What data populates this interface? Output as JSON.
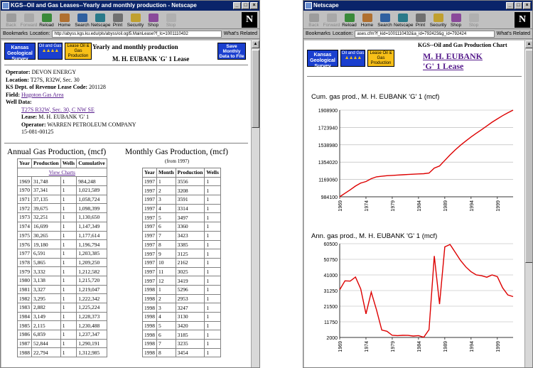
{
  "left_window": {
    "title": "KGS--Oil and Gas Leases--Yearly and monthly production - Netscape",
    "toolbar": [
      "Back",
      "Forward",
      "Reload",
      "Home",
      "Search",
      "Netscape",
      "Print",
      "Security",
      "Shop",
      "Stop"
    ],
    "bookmarks": "Bookmarks",
    "location_label": "Location:",
    "url": "http://abyss.kgs.ku.edu/pls/abyss/oil.ogl5.MainLease?f_lc=1001110432",
    "related": "What's Related",
    "logos": {
      "kgs": "Kansas Geological Survey",
      "oil_gas": "Oil and Gas",
      "lease": "Lease Oil & Gas Production",
      "save": "Save Monthly Data to File"
    },
    "heading": "Yearly and monthly production",
    "lease_title": "M. H. EUBANK 'G' 1 Lease",
    "info": [
      {
        "label": "Operator:",
        "value": "DEVON ENERGY"
      },
      {
        "label": "Location:",
        "value": "T27S, R32W, Sec. 30"
      },
      {
        "label": "KS Dept. of Revenue Lease Code:",
        "value": "201128"
      }
    ],
    "field_label": "Field:",
    "field_value": "Hugoton Gas Area",
    "well_data_label": "Well Data:",
    "well_link": "T27S R32W, Sec. 30, C NW SE",
    "well_lease_label": "Lease:",
    "well_lease_value": "M. H. EUBANK 'G' 1",
    "well_operator_label": "Operator:",
    "well_operator_value": "WARREN PETROLEUM COMPANY",
    "api": "15-081-00125",
    "annual_title": "Annual Gas Production, (mcf)",
    "monthly_title": "Monthly Gas Production, (mcf)",
    "monthly_sub": "(from 1997)",
    "view_charts": "View Charts",
    "annual_headers": [
      "Year",
      "Production",
      "Wells",
      "Cumulative"
    ],
    "annual_rows": [
      [
        "1969",
        "31,748",
        "1",
        "984,248"
      ],
      [
        "1970",
        "37,341",
        "1",
        "1,021,589"
      ],
      [
        "1971",
        "37,135",
        "1",
        "1,058,724"
      ],
      [
        "1972",
        "39,675",
        "1",
        "1,098,399"
      ],
      [
        "1973",
        "32,251",
        "1",
        "1,130,650"
      ],
      [
        "1974",
        "16,699",
        "1",
        "1,147,349"
      ],
      [
        "1975",
        "30,265",
        "1",
        "1,177,614"
      ],
      [
        "1976",
        "19,180",
        "1",
        "1,196,794"
      ],
      [
        "1977",
        "6,591",
        "1",
        "1,203,385"
      ],
      [
        "1978",
        "5,865",
        "1",
        "1,209,250"
      ],
      [
        "1979",
        "3,332",
        "1",
        "1,212,582"
      ],
      [
        "1980",
        "3,138",
        "1",
        "1,215,720"
      ],
      [
        "1981",
        "3,327",
        "1",
        "1,219,047"
      ],
      [
        "1982",
        "3,295",
        "1",
        "1,222,342"
      ],
      [
        "1983",
        "2,882",
        "1",
        "1,225,224"
      ],
      [
        "1984",
        "3,149",
        "1",
        "1,228,373"
      ],
      [
        "1985",
        "2,115",
        "1",
        "1,230,488"
      ],
      [
        "1986",
        "6,859",
        "1",
        "1,237,347"
      ],
      [
        "1987",
        "52,844",
        "1",
        "1,290,191"
      ],
      [
        "1988",
        "22,794",
        "1",
        "1,312,985"
      ]
    ],
    "monthly_headers": [
      "Year",
      "Month",
      "Production",
      "Wells"
    ],
    "monthly_rows": [
      [
        "1997",
        "1",
        "3556",
        "1"
      ],
      [
        "1997",
        "2",
        "3208",
        "1"
      ],
      [
        "1997",
        "3",
        "3591",
        "1"
      ],
      [
        "1997",
        "4",
        "3314",
        "1"
      ],
      [
        "1997",
        "5",
        "3497",
        "1"
      ],
      [
        "1997",
        "6",
        "3360",
        "1"
      ],
      [
        "1997",
        "7",
        "3423",
        "1"
      ],
      [
        "1997",
        "8",
        "3385",
        "1"
      ],
      [
        "1997",
        "9",
        "3125",
        "1"
      ],
      [
        "1997",
        "10",
        "2162",
        "1"
      ],
      [
        "1997",
        "11",
        "3025",
        "1"
      ],
      [
        "1997",
        "12",
        "3419",
        "1"
      ],
      [
        "1998",
        "1",
        "5296",
        "1"
      ],
      [
        "1998",
        "2",
        "2953",
        "1"
      ],
      [
        "1998",
        "3",
        "3247",
        "1"
      ],
      [
        "1998",
        "4",
        "3130",
        "1"
      ],
      [
        "1998",
        "5",
        "3420",
        "1"
      ],
      [
        "1998",
        "6",
        "3185",
        "1"
      ],
      [
        "1998",
        "7",
        "3235",
        "1"
      ],
      [
        "1998",
        "8",
        "3454",
        "1"
      ]
    ]
  },
  "right_window": {
    "title": "Netscape",
    "toolbar": [
      "Back",
      "Forward",
      "Reload",
      "Home",
      "Search",
      "Netscape",
      "Print",
      "Security",
      "Shop",
      "Stop"
    ],
    "bookmarks": "Bookmarks",
    "location_label": "Location:",
    "url": "ases.cfm?f_kid=1001110432&a_id=792423&g_id=792424",
    "related": "What's Related",
    "header": "KGS--Oil and Gas Production Chart",
    "lease_link": "M. H. EUBANK 'G' 1 Lease",
    "logos": {
      "kgs": "Kansas Geological Survey",
      "oil_gas": "Oil and Gas",
      "lease": "Lease Oil & Gas Production"
    }
  },
  "colors": {
    "line": "#dd0000",
    "link": "#551a8b",
    "title_bar": "#0a246a",
    "logo_blue": "#1a3fcf",
    "logo_gold": "#f8c018"
  },
  "chart_data": [
    {
      "type": "line",
      "title": "Cum. gas prod., M. H. EUBANK 'G' 1 (mcf)",
      "x": [
        1969,
        1970,
        1971,
        1972,
        1973,
        1974,
        1975,
        1976,
        1977,
        1978,
        1979,
        1980,
        1981,
        1982,
        1983,
        1984,
        1985,
        1986,
        1987,
        1988,
        1989,
        1990,
        1991,
        1992,
        1993,
        1994,
        1995,
        1996,
        1997,
        1998,
        1999,
        2000,
        2001,
        2002
      ],
      "y": [
        984248,
        1021589,
        1058724,
        1098399,
        1130650,
        1147349,
        1177614,
        1196794,
        1203385,
        1209250,
        1212582,
        1215720,
        1219047,
        1222342,
        1225224,
        1228373,
        1230488,
        1237347,
        1290191,
        1312985,
        1372000,
        1431000,
        1485000,
        1535000,
        1580000,
        1622000,
        1662000,
        1700000,
        1740000,
        1780000,
        1815000,
        1850000,
        1880000,
        1908900
      ],
      "yticks": [
        984100,
        1169060,
        1354020,
        1538980,
        1723940,
        1908900
      ],
      "xticks": [
        1969,
        1974,
        1979,
        1984,
        1989,
        1994,
        1999
      ],
      "ylim": [
        984100,
        1908900
      ],
      "xlim": [
        1969,
        2002
      ]
    },
    {
      "type": "line",
      "title": "Ann. gas prod., M. H. EUBANK 'G' 1 (mcf)",
      "x": [
        1969,
        1970,
        1971,
        1972,
        1973,
        1974,
        1975,
        1976,
        1977,
        1978,
        1979,
        1980,
        1981,
        1982,
        1983,
        1984,
        1985,
        1986,
        1987,
        1988,
        1989,
        1990,
        1991,
        1992,
        1993,
        1994,
        1995,
        1996,
        1997,
        1998,
        1999,
        2000,
        2001,
        2002
      ],
      "y": [
        31748,
        37341,
        37135,
        39675,
        32251,
        16699,
        30265,
        19180,
        6591,
        5865,
        3332,
        3138,
        3327,
        3295,
        2882,
        3149,
        2115,
        6859,
        52844,
        22794,
        58500,
        60000,
        55000,
        50000,
        46000,
        43000,
        41000,
        40500,
        39566,
        41000,
        40000,
        33000,
        28500,
        27500
      ],
      "yticks": [
        2000,
        11750,
        21500,
        31250,
        41000,
        50750,
        60500
      ],
      "xticks": [
        1969,
        1974,
        1979,
        1984,
        1989,
        1994,
        1999
      ],
      "ylim": [
        2000,
        60500
      ],
      "xlim": [
        1969,
        2002
      ]
    }
  ]
}
